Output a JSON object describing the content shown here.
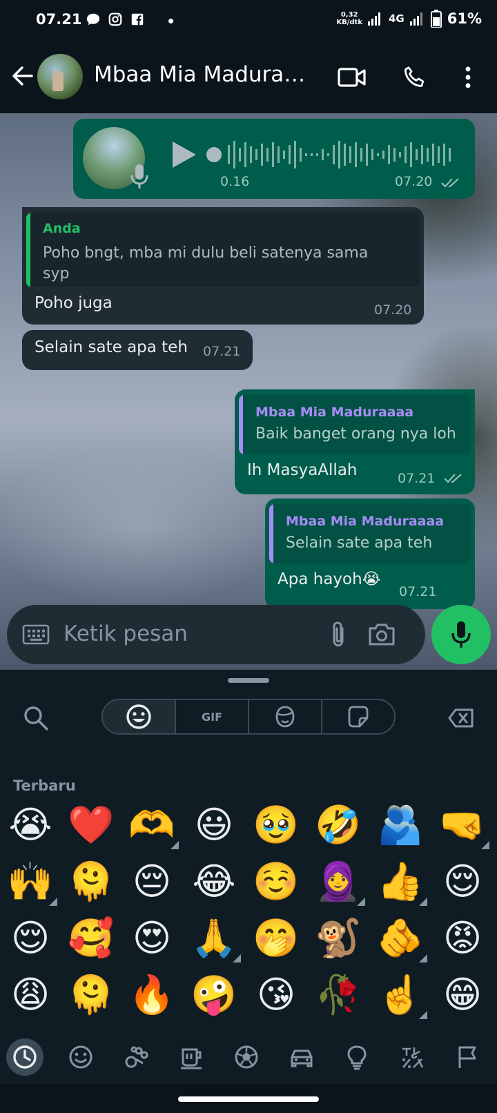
{
  "status_bar": {
    "time": "07.21",
    "speed_value": "0,32",
    "speed_unit": "KB/dtk",
    "network": "4G",
    "battery": "61%"
  },
  "header": {
    "contact_name": "Mbaa Mia Maduraa…"
  },
  "messages": {
    "voice": {
      "duration": "0.16",
      "time": "07.20"
    },
    "m1": {
      "quote_author": "Anda",
      "quote_text_l1": "Poho bngt, mba mi dulu beli satenya sama",
      "quote_text_l2": "syp",
      "text": "Poho juga",
      "time": "07.20"
    },
    "m2": {
      "text": "Selain sate apa teh",
      "time": "07.21"
    },
    "m3": {
      "quote_author": "Mbaa Mia Maduraaaa",
      "quote_text": "Baik banget orang nya loh",
      "text": "Ih MasyaAllah",
      "time": "07.21"
    },
    "m4": {
      "quote_author": "Mbaa Mia Maduraaaa",
      "quote_text": "Selain sate apa teh",
      "text": "Apa hayoh😭",
      "time": "07.21"
    }
  },
  "composer": {
    "placeholder": "Ketik pesan"
  },
  "emoji_panel": {
    "tabs": [
      "emoji",
      "GIF",
      "avatar",
      "sticker"
    ],
    "section": "Terbaru",
    "emojis": [
      [
        "😭",
        "❤️",
        "🫶",
        "😃",
        "🥹",
        "🤣",
        "🫂",
        "🤜"
      ],
      [
        "🙌",
        "🫠",
        "😔",
        "😂",
        "☺️",
        "🧕",
        "👍",
        "😌"
      ],
      [
        "😌",
        "🥰",
        "😍",
        "🙏",
        "🤭",
        "🐒",
        "🫵",
        "😡"
      ],
      [
        "😩",
        "🫠",
        "🔥",
        "🤪",
        "😘",
        "🥀",
        "☝️",
        "😁"
      ]
    ]
  },
  "colors": {
    "accent_green": "#21c063",
    "outgoing_bubble": "#005c4b",
    "incoming_bubble": "#1f2c34",
    "quote_self": "#21c063",
    "quote_contact": "#a68cf5"
  }
}
